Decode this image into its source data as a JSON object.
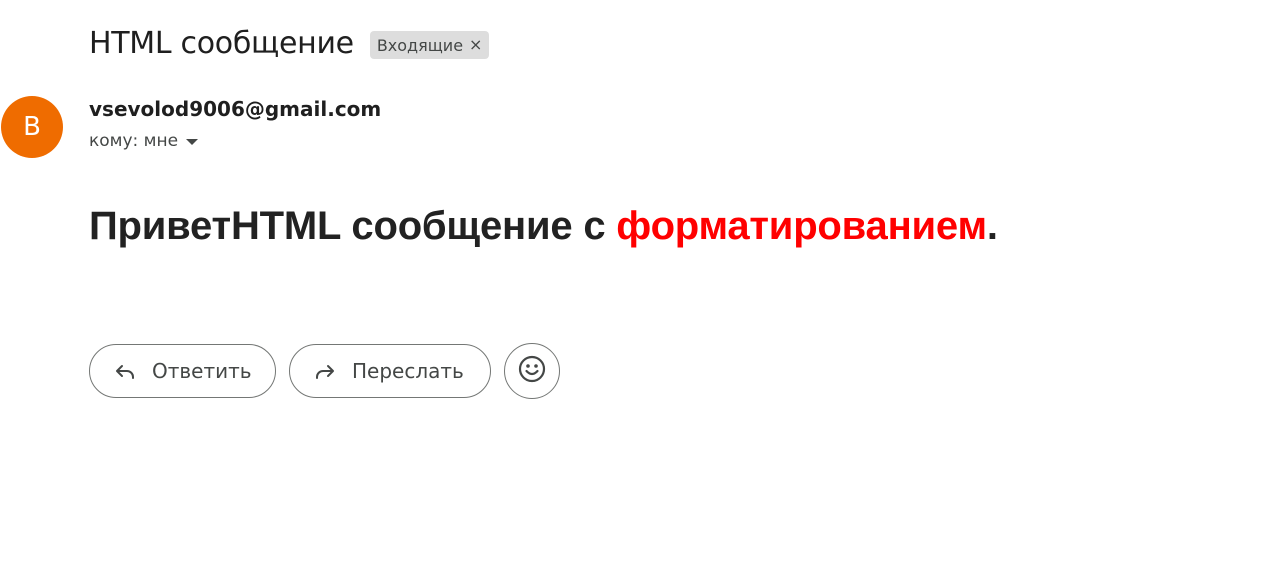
{
  "email": {
    "subject": "HTML сообщение",
    "label_chip": {
      "text": "Входящие",
      "remove_glyph": "×"
    },
    "sender": {
      "avatar_letter": "B",
      "avatar_color": "#ef6c00",
      "address": "vsevolod9006@gmail.com",
      "recipient_text": "кому: мне"
    },
    "body": {
      "text_before": "ПриветHTML сообщение с ",
      "highlighted": "форматированием",
      "highlight_color": "#ff0000",
      "text_after": "."
    },
    "actions": {
      "reply_label": "Ответить",
      "forward_label": "Переслать",
      "reply_icon": "reply-arrow-icon",
      "forward_icon": "forward-arrow-icon",
      "emoji_icon": "smiley-face-icon"
    }
  }
}
